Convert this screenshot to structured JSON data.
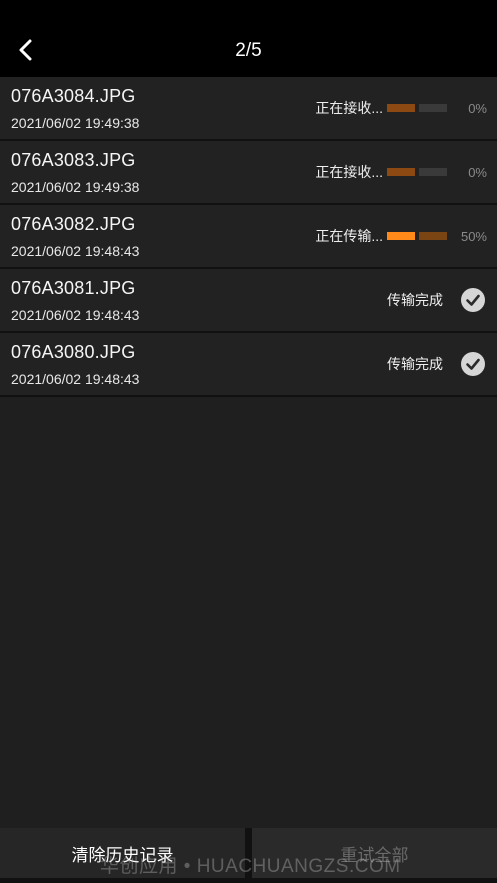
{
  "header": {
    "title": "2/5",
    "back_icon": "chevron-left-icon"
  },
  "items": [
    {
      "name": "076A3084.JPG",
      "date": "2021/06/02 19:49:38",
      "status": "正在接收...",
      "progress_label": "0%",
      "progress": 0,
      "state": "receiving"
    },
    {
      "name": "076A3083.JPG",
      "date": "2021/06/02 19:49:38",
      "status": "正在接收...",
      "progress_label": "0%",
      "progress": 0,
      "state": "receiving"
    },
    {
      "name": "076A3082.JPG",
      "date": "2021/06/02 19:48:43",
      "status": "正在传输...",
      "progress_label": "50%",
      "progress": 0.5,
      "state": "transferring"
    },
    {
      "name": "076A3081.JPG",
      "date": "2021/06/02 19:48:43",
      "status": "传输完成",
      "state": "done",
      "icon": "check-circle-icon"
    },
    {
      "name": "076A3080.JPG",
      "date": "2021/06/02 19:48:43",
      "status": "传输完成",
      "state": "done",
      "icon": "check-circle-icon"
    }
  ],
  "footer": {
    "clear_label": "清除历史记录",
    "retry_label": "重试全部"
  },
  "watermark": "华创应用 • HUACHUANGZS.COM",
  "colors": {
    "accent": "#ff8a1a",
    "accent_dim": "#8c4a12",
    "background": "#1f1f1f",
    "row": "#222222"
  }
}
